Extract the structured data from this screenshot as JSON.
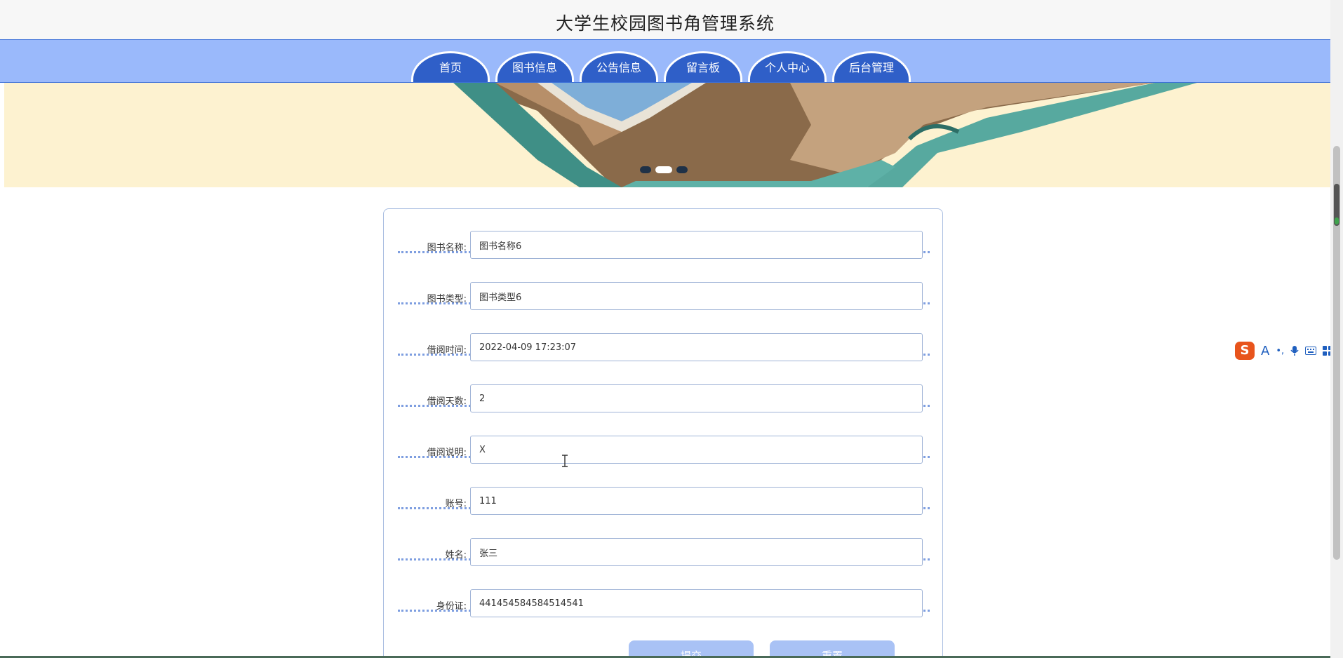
{
  "header": {
    "title": "大学生校园图书角管理系统"
  },
  "nav": {
    "items": [
      {
        "label": "首页"
      },
      {
        "label": "图书信息"
      },
      {
        "label": "公告信息"
      },
      {
        "label": "留言板"
      },
      {
        "label": "个人中心"
      },
      {
        "label": "后台管理"
      }
    ]
  },
  "carousel": {
    "dots": 3,
    "active_index": 1
  },
  "form": {
    "fields": [
      {
        "label": "图书名称:",
        "value": "图书名称6"
      },
      {
        "label": "图书类型:",
        "value": "图书类型6"
      },
      {
        "label": "借阅时间:",
        "value": "2022-04-09 17:23:07"
      },
      {
        "label": "借阅天数:",
        "value": "2"
      },
      {
        "label": "借阅说明:",
        "value": "X"
      },
      {
        "label": "账号:",
        "value": "111"
      },
      {
        "label": "姓名:",
        "value": "张三"
      },
      {
        "label": "身份证:",
        "value": "441454584584514541"
      }
    ],
    "submit_label": "提交",
    "reset_label": "重置"
  },
  "ime_toolbar": {
    "logo": "S",
    "items": [
      "A",
      "•,",
      "mic-icon",
      "keyboard-icon",
      "grid-icon"
    ]
  },
  "colors": {
    "nav_bg": "#9ab9fb",
    "tab_bg": "#2f5fc8",
    "banner_bg": "#fdf2d0",
    "button_bg": "#a9c2f5",
    "row_divider": "#7e9ee0"
  }
}
